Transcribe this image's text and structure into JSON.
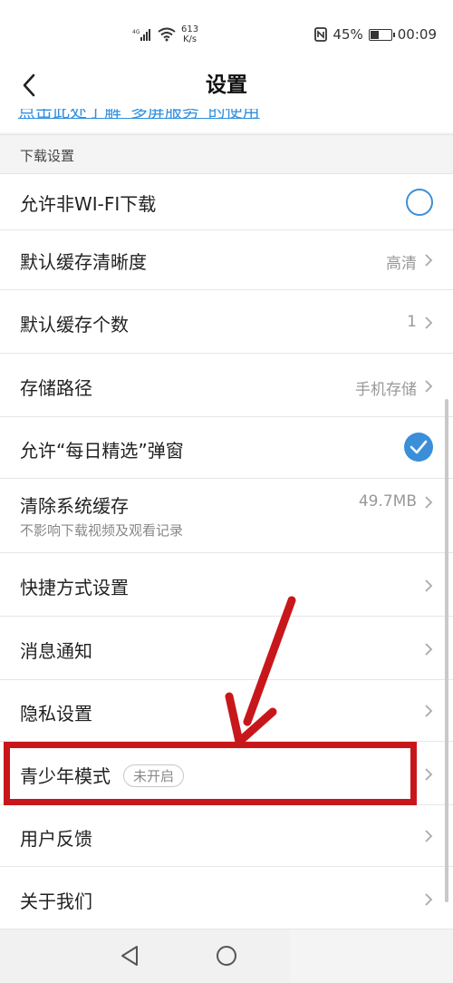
{
  "status_bar": {
    "network": "4G",
    "speed_value": "613",
    "speed_unit": "K/s",
    "battery_text": "45%",
    "battery_level": 0.45,
    "time": "00:09"
  },
  "header": {
    "title": "设置"
  },
  "link_text": "点击此处了解“多屏服务”的使用",
  "section": {
    "title": "下载设置"
  },
  "settings": {
    "allow_non_wifi": {
      "label": "允许非WI-FI下载",
      "enabled": false
    },
    "cache_quality": {
      "label": "默认缓存清晰度",
      "value": "高清"
    },
    "cache_count": {
      "label": "默认缓存个数",
      "value": "1"
    },
    "storage_path": {
      "label": "存储路径",
      "value": "手机存储"
    },
    "daily_popup": {
      "label": "允许“每日精选”弹窗",
      "enabled": true
    },
    "clear_cache": {
      "label": "清除系统缓存",
      "sub": "不影响下载视频及观看记录",
      "value": "49.7MB"
    },
    "shortcut": {
      "label": "快捷方式设置"
    },
    "notifications": {
      "label": "消息通知"
    },
    "privacy": {
      "label": "隐私设置"
    },
    "teen_mode": {
      "label": "青少年模式",
      "badge": "未开启"
    },
    "feedback": {
      "label": "用户反馈"
    },
    "about": {
      "label": "关于我们"
    }
  },
  "colors": {
    "accent": "#3a8fd8",
    "highlight": "#c8171b",
    "link": "#2f8fe0"
  },
  "icons": {
    "back": "chevron-left-icon",
    "row_arrow": "chevron-right-icon",
    "nav_back": "triangle-back-icon",
    "nav_home": "circle-home-icon"
  }
}
